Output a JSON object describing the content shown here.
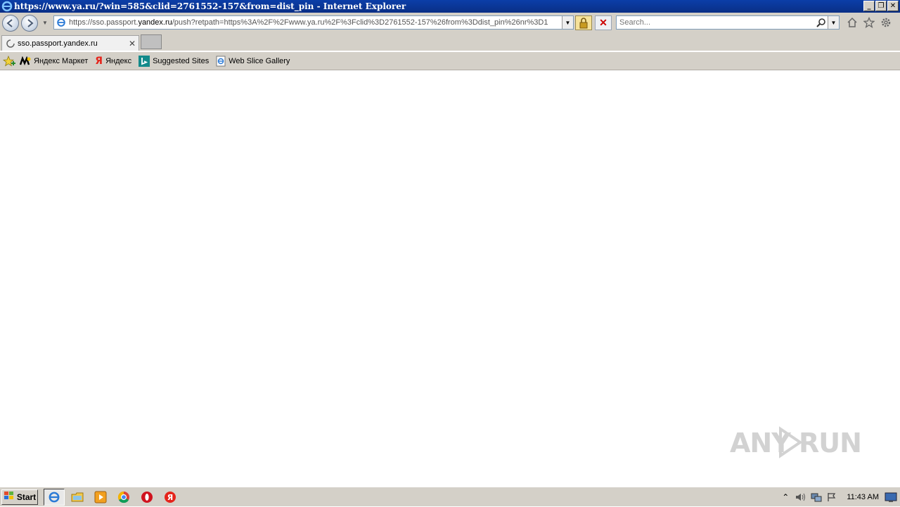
{
  "window": {
    "title": "https://www.ya.ru/?win=585&clid=2761552-157&from=dist_pin - Internet Explorer"
  },
  "address_bar": {
    "prefix": "https://sso.passport.",
    "domain": "yandex.ru",
    "suffix": "/push?retpath=https%3A%2F%2Fwww.ya.ru%2F%3Fclid%3D2761552-157%26from%3Ddist_pin%26nr%3D1"
  },
  "search": {
    "placeholder": "Search..."
  },
  "tabs": [
    {
      "label": "sso.passport.yandex.ru"
    }
  ],
  "favorites": [
    {
      "label": "Яндекс Маркет"
    },
    {
      "label": "Яндекс"
    },
    {
      "label": "Suggested Sites"
    },
    {
      "label": "Web Slice Gallery"
    }
  ],
  "watermark": {
    "text": "ANY RUN"
  },
  "taskbar": {
    "start_label": "Start",
    "clock": "11:43 AM"
  },
  "colors": {
    "titlebar": "#0a2f86",
    "chrome": "#d4d0c8",
    "yandex_red": "#e5241b"
  }
}
